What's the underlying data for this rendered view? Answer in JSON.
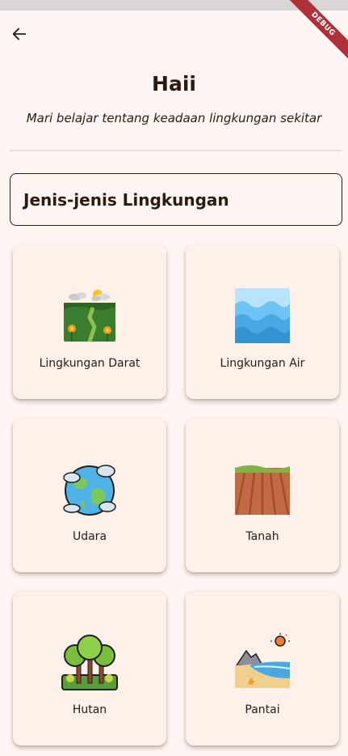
{
  "app": {
    "debug_banner": "DEBUG"
  },
  "header": {
    "title": "Haii",
    "subtitle": "Mari belajar tentang keadaan lingkungan sekitar"
  },
  "section": {
    "title": "Jenis-jenis Lingkungan"
  },
  "cards": [
    {
      "label": "Lingkungan Darat",
      "icon": "land-icon"
    },
    {
      "label": "Lingkungan Air",
      "icon": "water-icon"
    },
    {
      "label": "Udara",
      "icon": "earth-air-icon"
    },
    {
      "label": "Tanah",
      "icon": "soil-icon"
    },
    {
      "label": "Hutan",
      "icon": "forest-icon"
    },
    {
      "label": "Pantai",
      "icon": "beach-icon"
    }
  ],
  "colors": {
    "background": "#fff5f2",
    "card": "#fff0ea",
    "text": "#2a1a12",
    "debug": "#b0303a"
  }
}
